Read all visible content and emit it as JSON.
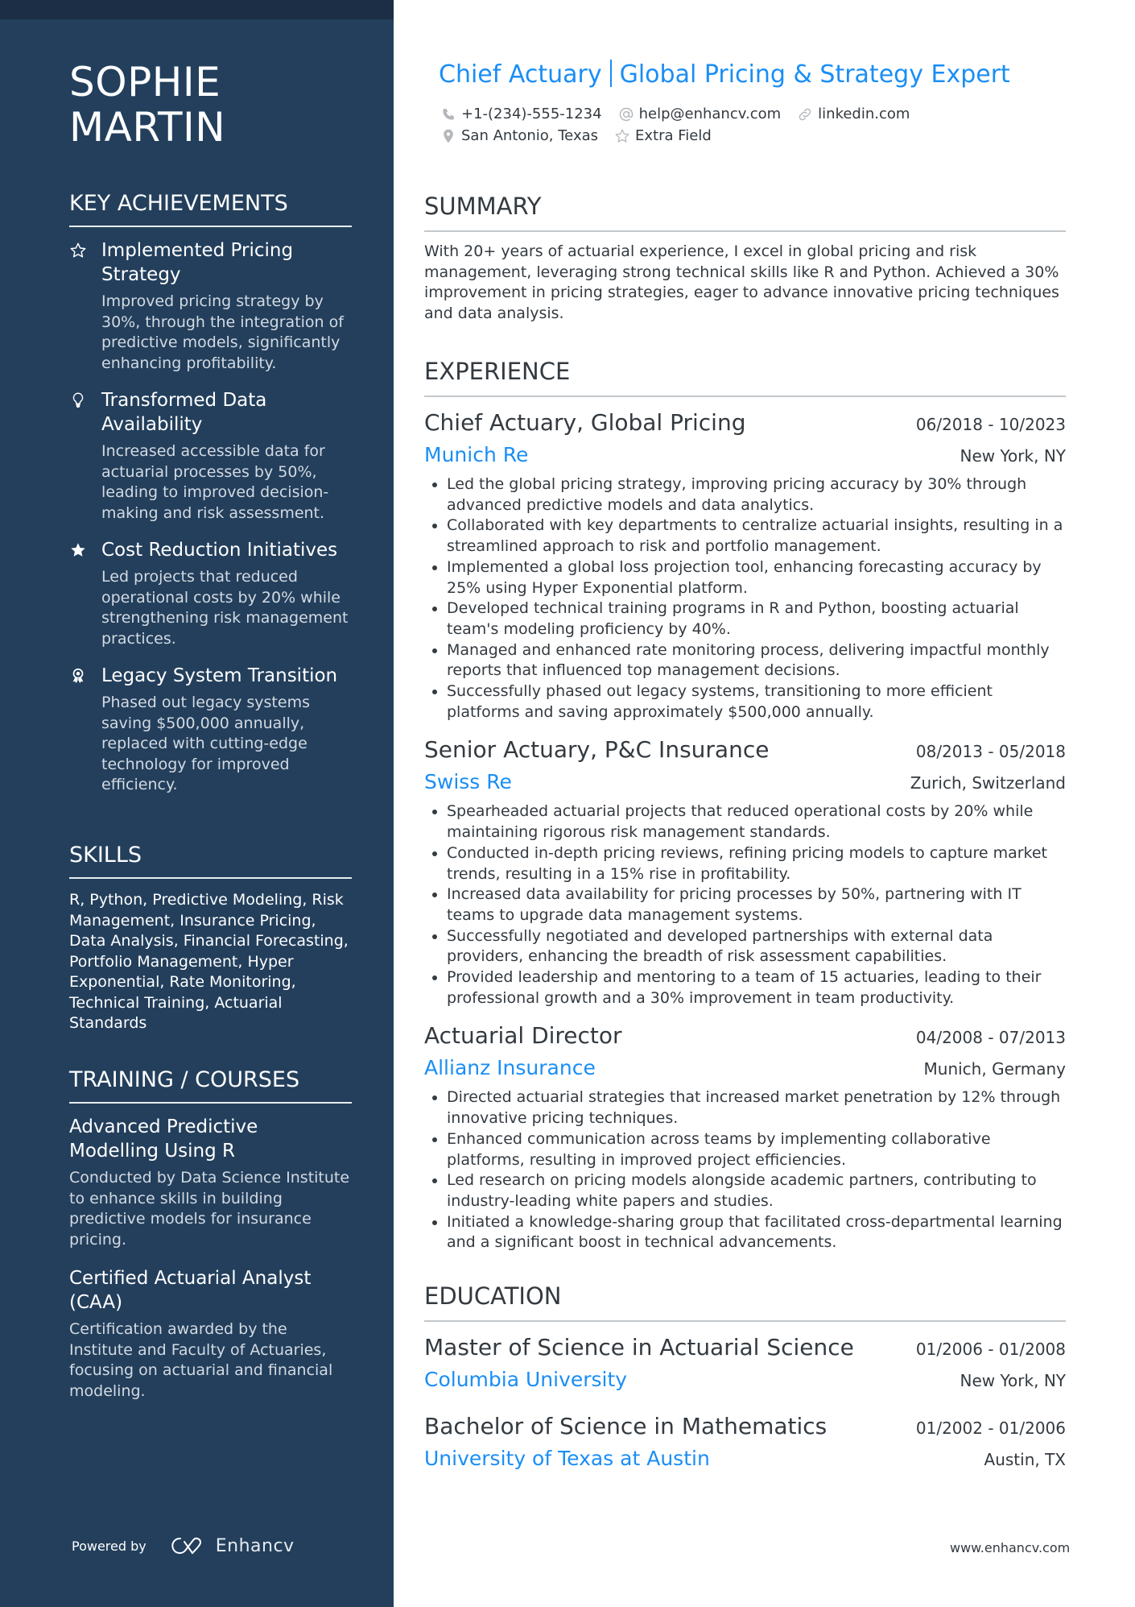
{
  "header": {
    "name": "SOPHIE\nMARTIN",
    "title_part1": "Chief Actuary",
    "title_part2": "Global Pricing & Strategy Expert",
    "contacts": {
      "phone": "+1-(234)-555-1234",
      "email": "help@enhancv.com",
      "linkedin": "linkedin.com",
      "location": "San Antonio, Texas",
      "extra": "Extra Field"
    }
  },
  "sidebar": {
    "achievements": {
      "heading": "KEY ACHIEVEMENTS",
      "items": [
        {
          "icon": "star-outline-icon",
          "title": "Implemented Pricing Strategy",
          "desc": "Improved pricing strategy by 30%, through the integration of predictive models, significantly enhancing profitability."
        },
        {
          "icon": "lightbulb-icon",
          "title": "Transformed Data Availability",
          "desc": "Increased accessible data for actuarial processes by 50%, leading to improved decision-making and risk assessment."
        },
        {
          "icon": "star-filled-icon",
          "title": "Cost Reduction Initiatives",
          "desc": "Led projects that reduced operational costs by 20% while strengthening risk management practices."
        },
        {
          "icon": "award-ribbon-icon",
          "title": "Legacy System Transition",
          "desc": "Phased out legacy systems saving $500,000 annually, replaced with cutting-edge technology for improved efficiency."
        }
      ]
    },
    "skills": {
      "heading": "SKILLS",
      "text": "R, Python, Predictive Modeling, Risk Management, Insurance Pricing, Data Analysis, Financial Forecasting, Portfolio Management, Hyper Exponential, Rate Monitoring, Technical Training, Actuarial Standards"
    },
    "training": {
      "heading": "TRAINING / COURSES",
      "items": [
        {
          "title": "Advanced Predictive Modelling Using R",
          "desc": "Conducted by Data Science Institute to enhance skills in building predictive models for insurance pricing."
        },
        {
          "title": "Certified Actuarial Analyst (CAA)",
          "desc": "Certification awarded by the Institute and Faculty of Actuaries, focusing on actuarial and financial modeling."
        }
      ]
    },
    "powered_by": "Powered by",
    "brand": "Enhancv"
  },
  "summary": {
    "heading": "SUMMARY",
    "text": "With 20+ years of actuarial experience, I excel in global pricing and risk management, leveraging strong technical skills like R and Python. Achieved a 30% improvement in pricing strategies, eager to advance innovative pricing techniques and data analysis."
  },
  "experience": {
    "heading": "EXPERIENCE",
    "jobs": [
      {
        "title": "Chief Actuary, Global Pricing",
        "dates": "06/2018 - 10/2023",
        "company": "Munich Re",
        "location": "New York, NY",
        "bullets": [
          "Led the global pricing strategy, improving pricing accuracy by 30% through advanced predictive models and data analytics.",
          "Collaborated with key departments to centralize actuarial insights, resulting in a streamlined approach to risk and portfolio management.",
          "Implemented a global loss projection tool, enhancing forecasting accuracy by 25% using Hyper Exponential platform.",
          "Developed technical training programs in R and Python, boosting actuarial team's modeling proficiency by 40%.",
          "Managed and enhanced rate monitoring process, delivering impactful monthly reports that influenced top management decisions.",
          "Successfully phased out legacy systems, transitioning to more efficient platforms and saving approximately $500,000 annually."
        ]
      },
      {
        "title": "Senior Actuary, P&C Insurance",
        "dates": "08/2013 - 05/2018",
        "company": "Swiss Re",
        "location": "Zurich, Switzerland",
        "bullets": [
          "Spearheaded actuarial projects that reduced operational costs by 20% while maintaining rigorous risk management standards.",
          "Conducted in-depth pricing reviews, refining pricing models to capture market trends, resulting in a 15% rise in profitability.",
          "Increased data availability for pricing processes by 50%, partnering with IT teams to upgrade data management systems.",
          "Successfully negotiated and developed partnerships with external data providers, enhancing the breadth of risk assessment capabilities.",
          "Provided leadership and mentoring to a team of 15 actuaries, leading to their professional growth and a 30% improvement in team productivity."
        ]
      },
      {
        "title": "Actuarial Director",
        "dates": "04/2008 - 07/2013",
        "company": "Allianz Insurance",
        "location": "Munich, Germany",
        "bullets": [
          "Directed actuarial strategies that increased market penetration by 12% through innovative pricing techniques.",
          "Enhanced communication across teams by implementing collaborative platforms, resulting in improved project efficiencies.",
          "Led research on pricing models alongside academic partners, contributing to industry-leading white papers and studies.",
          "Initiated a knowledge-sharing group that facilitated cross-departmental learning and a significant boost in technical advancements."
        ]
      }
    ]
  },
  "education": {
    "heading": "EDUCATION",
    "items": [
      {
        "degree": "Master of Science in Actuarial Science",
        "dates": "01/2006 - 01/2008",
        "school": "Columbia University",
        "location": "New York, NY"
      },
      {
        "degree": "Bachelor of Science in Mathematics",
        "dates": "01/2002 - 01/2006",
        "school": "University of Texas at Austin",
        "location": "Austin, TX"
      }
    ]
  },
  "footer": {
    "url": "www.enhancv.com"
  },
  "colors": {
    "sidebar": "#233f5c",
    "sidebar_top": "#1c2e45",
    "accent": "#1a8ef5",
    "text": "#333a40"
  }
}
